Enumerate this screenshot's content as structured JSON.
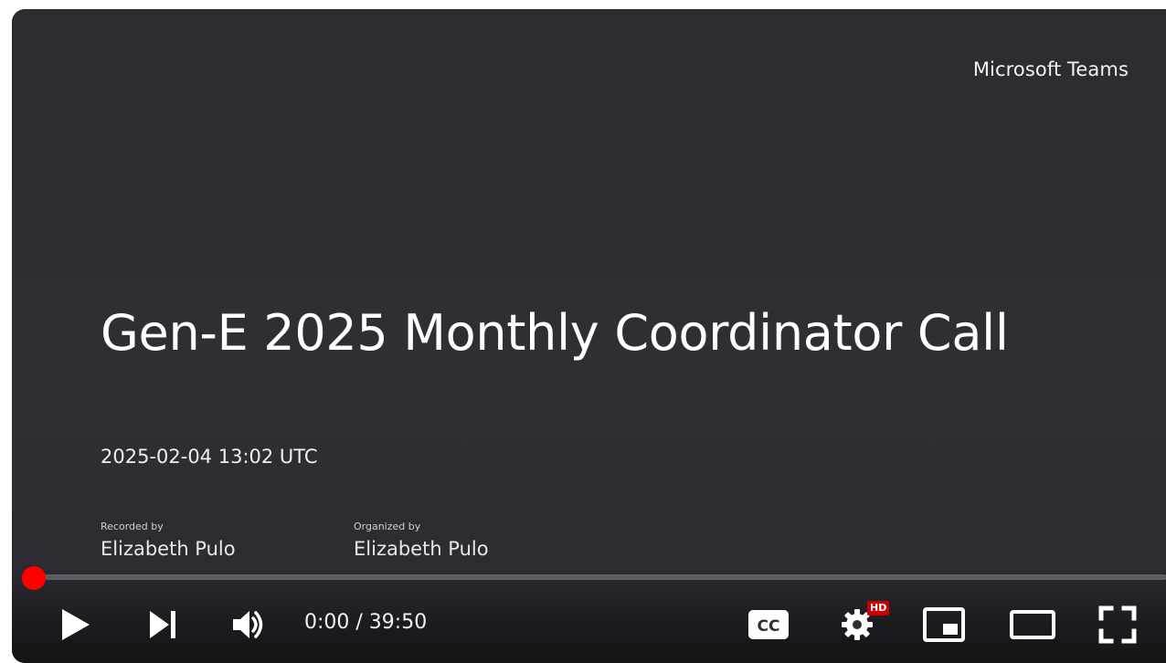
{
  "player": {
    "brand": "Microsoft Teams",
    "title": "Gen-E 2025 Monthly Coordinator Call",
    "datetime": "2025-02-04 13:02 UTC",
    "recorded_by_label": "Recorded by",
    "recorded_by_value": "Elizabeth Pulo",
    "organized_by_label": "Organized by",
    "organized_by_value": "Elizabeth Pulo"
  },
  "controls": {
    "current_time": "0:00",
    "separator": "/",
    "duration": "39:50",
    "time_display": "0:00 / 39:50",
    "hd_badge": "HD",
    "progress_fraction": 0,
    "icons": {
      "play": "play-icon",
      "next": "next-icon",
      "volume": "volume-icon",
      "captions": "captions-icon",
      "settings": "settings-icon",
      "miniplayer": "miniplayer-icon",
      "theater": "theater-mode-icon",
      "fullscreen": "fullscreen-icon"
    }
  },
  "colors": {
    "background": "#2d2d33",
    "progress_accent": "#ff0000",
    "hd_badge": "#cc0000",
    "text": "#ffffff"
  }
}
